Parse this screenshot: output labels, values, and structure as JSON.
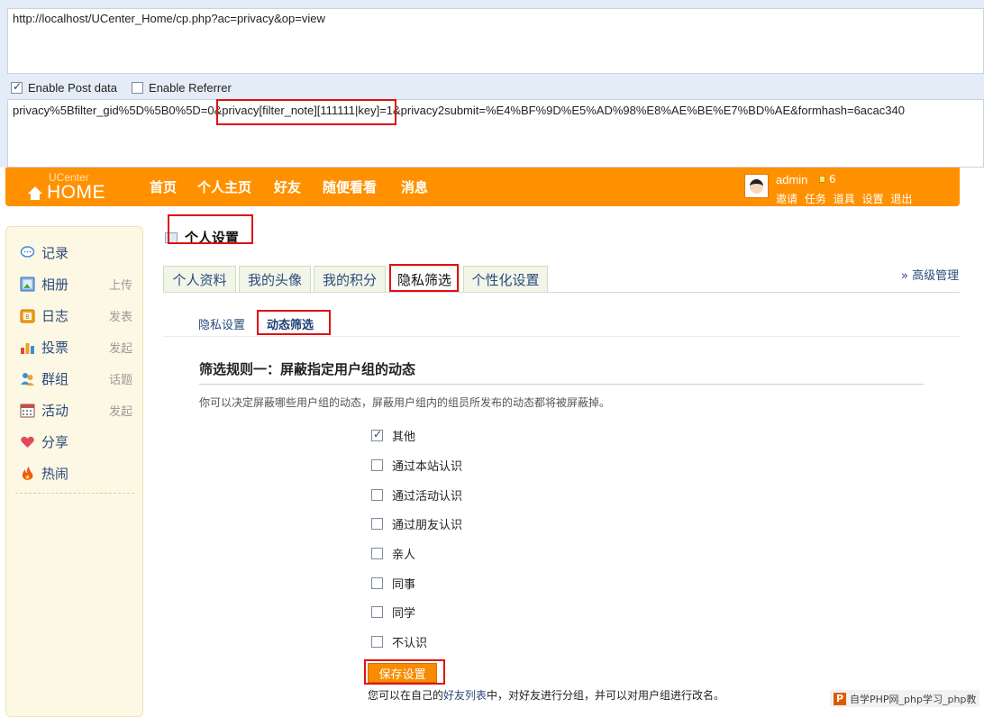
{
  "hackbar": {
    "url": "http://localhost/UCenter_Home/cp.php?ac=privacy&op=view",
    "enable_post_label": "Enable Post data",
    "enable_post_checked": true,
    "enable_referrer_label": "Enable Referrer",
    "enable_referrer_checked": false,
    "post_data": "privacy%5Bfilter_gid%5D%5B0%5D=0&privacy[filter_note][111111|key]=1&privacy2submit=%E4%BF%9D%E5%AD%98%E8%AE%BE%E7%BD%AE&formhash=6acac340"
  },
  "brand": {
    "small": "UCenter",
    "big": "HOME"
  },
  "nav": {
    "items": [
      "首页",
      "个人主页",
      "好友",
      "随便看看",
      "消息"
    ]
  },
  "user": {
    "name": "admin",
    "credits": "6",
    "links": [
      "邀请",
      "任务",
      "道具",
      "设置",
      "退出"
    ]
  },
  "sidebar": {
    "items": [
      {
        "label": "记录",
        "action": "",
        "icon": "speech-bubble-icon"
      },
      {
        "label": "相册",
        "action": "上传",
        "icon": "photo-icon"
      },
      {
        "label": "日志",
        "action": "发表",
        "icon": "blog-icon"
      },
      {
        "label": "投票",
        "action": "发起",
        "icon": "bar-chart-icon"
      },
      {
        "label": "群组",
        "action": "话题",
        "icon": "group-icon"
      },
      {
        "label": "活动",
        "action": "发起",
        "icon": "calendar-icon"
      },
      {
        "label": "分享",
        "action": "",
        "icon": "heart-icon"
      },
      {
        "label": "热闹",
        "action": "",
        "icon": "fire-icon"
      }
    ]
  },
  "page": {
    "title": "个人设置",
    "tabs": [
      "个人资料",
      "我的头像",
      "我的积分",
      "隐私筛选",
      "个性化设置"
    ],
    "active_tab": "隐私筛选",
    "advanced_link": "» 高级管理",
    "subtabs": [
      "隐私设置",
      "动态筛选"
    ],
    "active_subtab": "动态筛选"
  },
  "filter": {
    "title": "筛选规则一：屏蔽指定用户组的动态",
    "description": "你可以决定屏蔽哪些用户组的动态，屏蔽用户组内的组员所发布的动态都将被屏蔽掉。",
    "groups": [
      {
        "label": "其他",
        "checked": true
      },
      {
        "label": "通过本站认识",
        "checked": false
      },
      {
        "label": "通过活动认识",
        "checked": false
      },
      {
        "label": "通过朋友认识",
        "checked": false
      },
      {
        "label": "亲人",
        "checked": false
      },
      {
        "label": "同事",
        "checked": false
      },
      {
        "label": "同学",
        "checked": false
      },
      {
        "label": "不认识",
        "checked": false
      }
    ],
    "save_label": "保存设置",
    "note_prefix": "您可以在自己的",
    "note_link": "好友列表",
    "note_suffix": "中，对好友进行分组，并可以对用户组进行改名。"
  },
  "watermark": "自学PHP网_php学习_php教",
  "colors": {
    "accent": "#ff9100",
    "highlight": "#e01010",
    "link": "#2b4a7a"
  }
}
